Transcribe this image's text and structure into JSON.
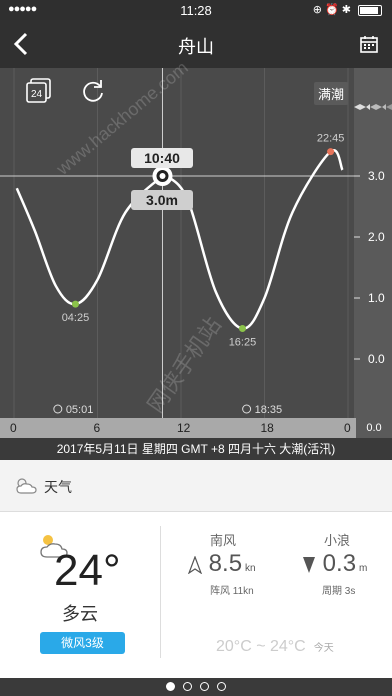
{
  "status_bar": {
    "signal": "●●●●●",
    "time": "11:28",
    "right_icons": "⊕ ⏰ ✱"
  },
  "nav": {
    "title": "舟山"
  },
  "chart_tools": {
    "date_badge": "24",
    "tide_state": "满潮",
    "fish": "🐟🐟🐟"
  },
  "tooltip": {
    "time": "10:40",
    "height": "3.0m"
  },
  "chart_data": {
    "type": "line",
    "title": "",
    "xlabel": "",
    "ylabel": "",
    "x_ticks": [
      "0",
      "6",
      "12",
      "18",
      "0"
    ],
    "y_ticks": [
      "3.0",
      "2.0",
      "1.0",
      "0.0"
    ],
    "ylim": [
      -0.5,
      3.5
    ],
    "xlim": [
      0,
      24
    ],
    "grid": true,
    "extremes": [
      {
        "time": "04:25",
        "height": 0.9,
        "type": "low"
      },
      {
        "time": "16:25",
        "height": 0.5,
        "type": "low"
      },
      {
        "time": "22:45",
        "height": 3.4,
        "type": "high"
      }
    ],
    "curve": [
      {
        "x": 0.2,
        "y": 2.8
      },
      {
        "x": 1.5,
        "y": 2.1
      },
      {
        "x": 3.0,
        "y": 1.2
      },
      {
        "x": 4.42,
        "y": 0.9
      },
      {
        "x": 6.0,
        "y": 1.3
      },
      {
        "x": 8.0,
        "y": 2.4
      },
      {
        "x": 10.67,
        "y": 3.0
      },
      {
        "x": 11.0,
        "y": 3.0
      },
      {
        "x": 12.5,
        "y": 2.6
      },
      {
        "x": 14.5,
        "y": 1.1
      },
      {
        "x": 16.42,
        "y": 0.5
      },
      {
        "x": 18.0,
        "y": 1.0
      },
      {
        "x": 20.0,
        "y": 2.4
      },
      {
        "x": 22.75,
        "y": 3.4
      },
      {
        "x": 23.6,
        "y": 3.1
      }
    ],
    "sunrise": "05:01",
    "sunset": "18:35",
    "right_edge_value": "0.0"
  },
  "date_bar": "2017年5月11日 星期四 GMT +8  四月十六 大潮(活汛)",
  "weather": {
    "section_label": "天气",
    "temperature": "24°",
    "condition": "多云",
    "breeze": "微风3级",
    "wind_direction": "南风",
    "wind_speed": "8.5",
    "wind_unit": "kn",
    "gust": "阵风 11kn",
    "wave_name": "小浪",
    "wave_height": "0.3",
    "wave_unit": "m",
    "period": "周期 3s",
    "temp_range": "20°C ~ 24°C",
    "today": "今天"
  },
  "watermark": "www.hackhome.com",
  "watermark2": "网侠手机站",
  "colors": {
    "accent_blue": "#2aa9e8",
    "low_dot": "#8bc34a",
    "high_dot": "#e8745a"
  },
  "pages": {
    "count": 4,
    "active": 0
  }
}
